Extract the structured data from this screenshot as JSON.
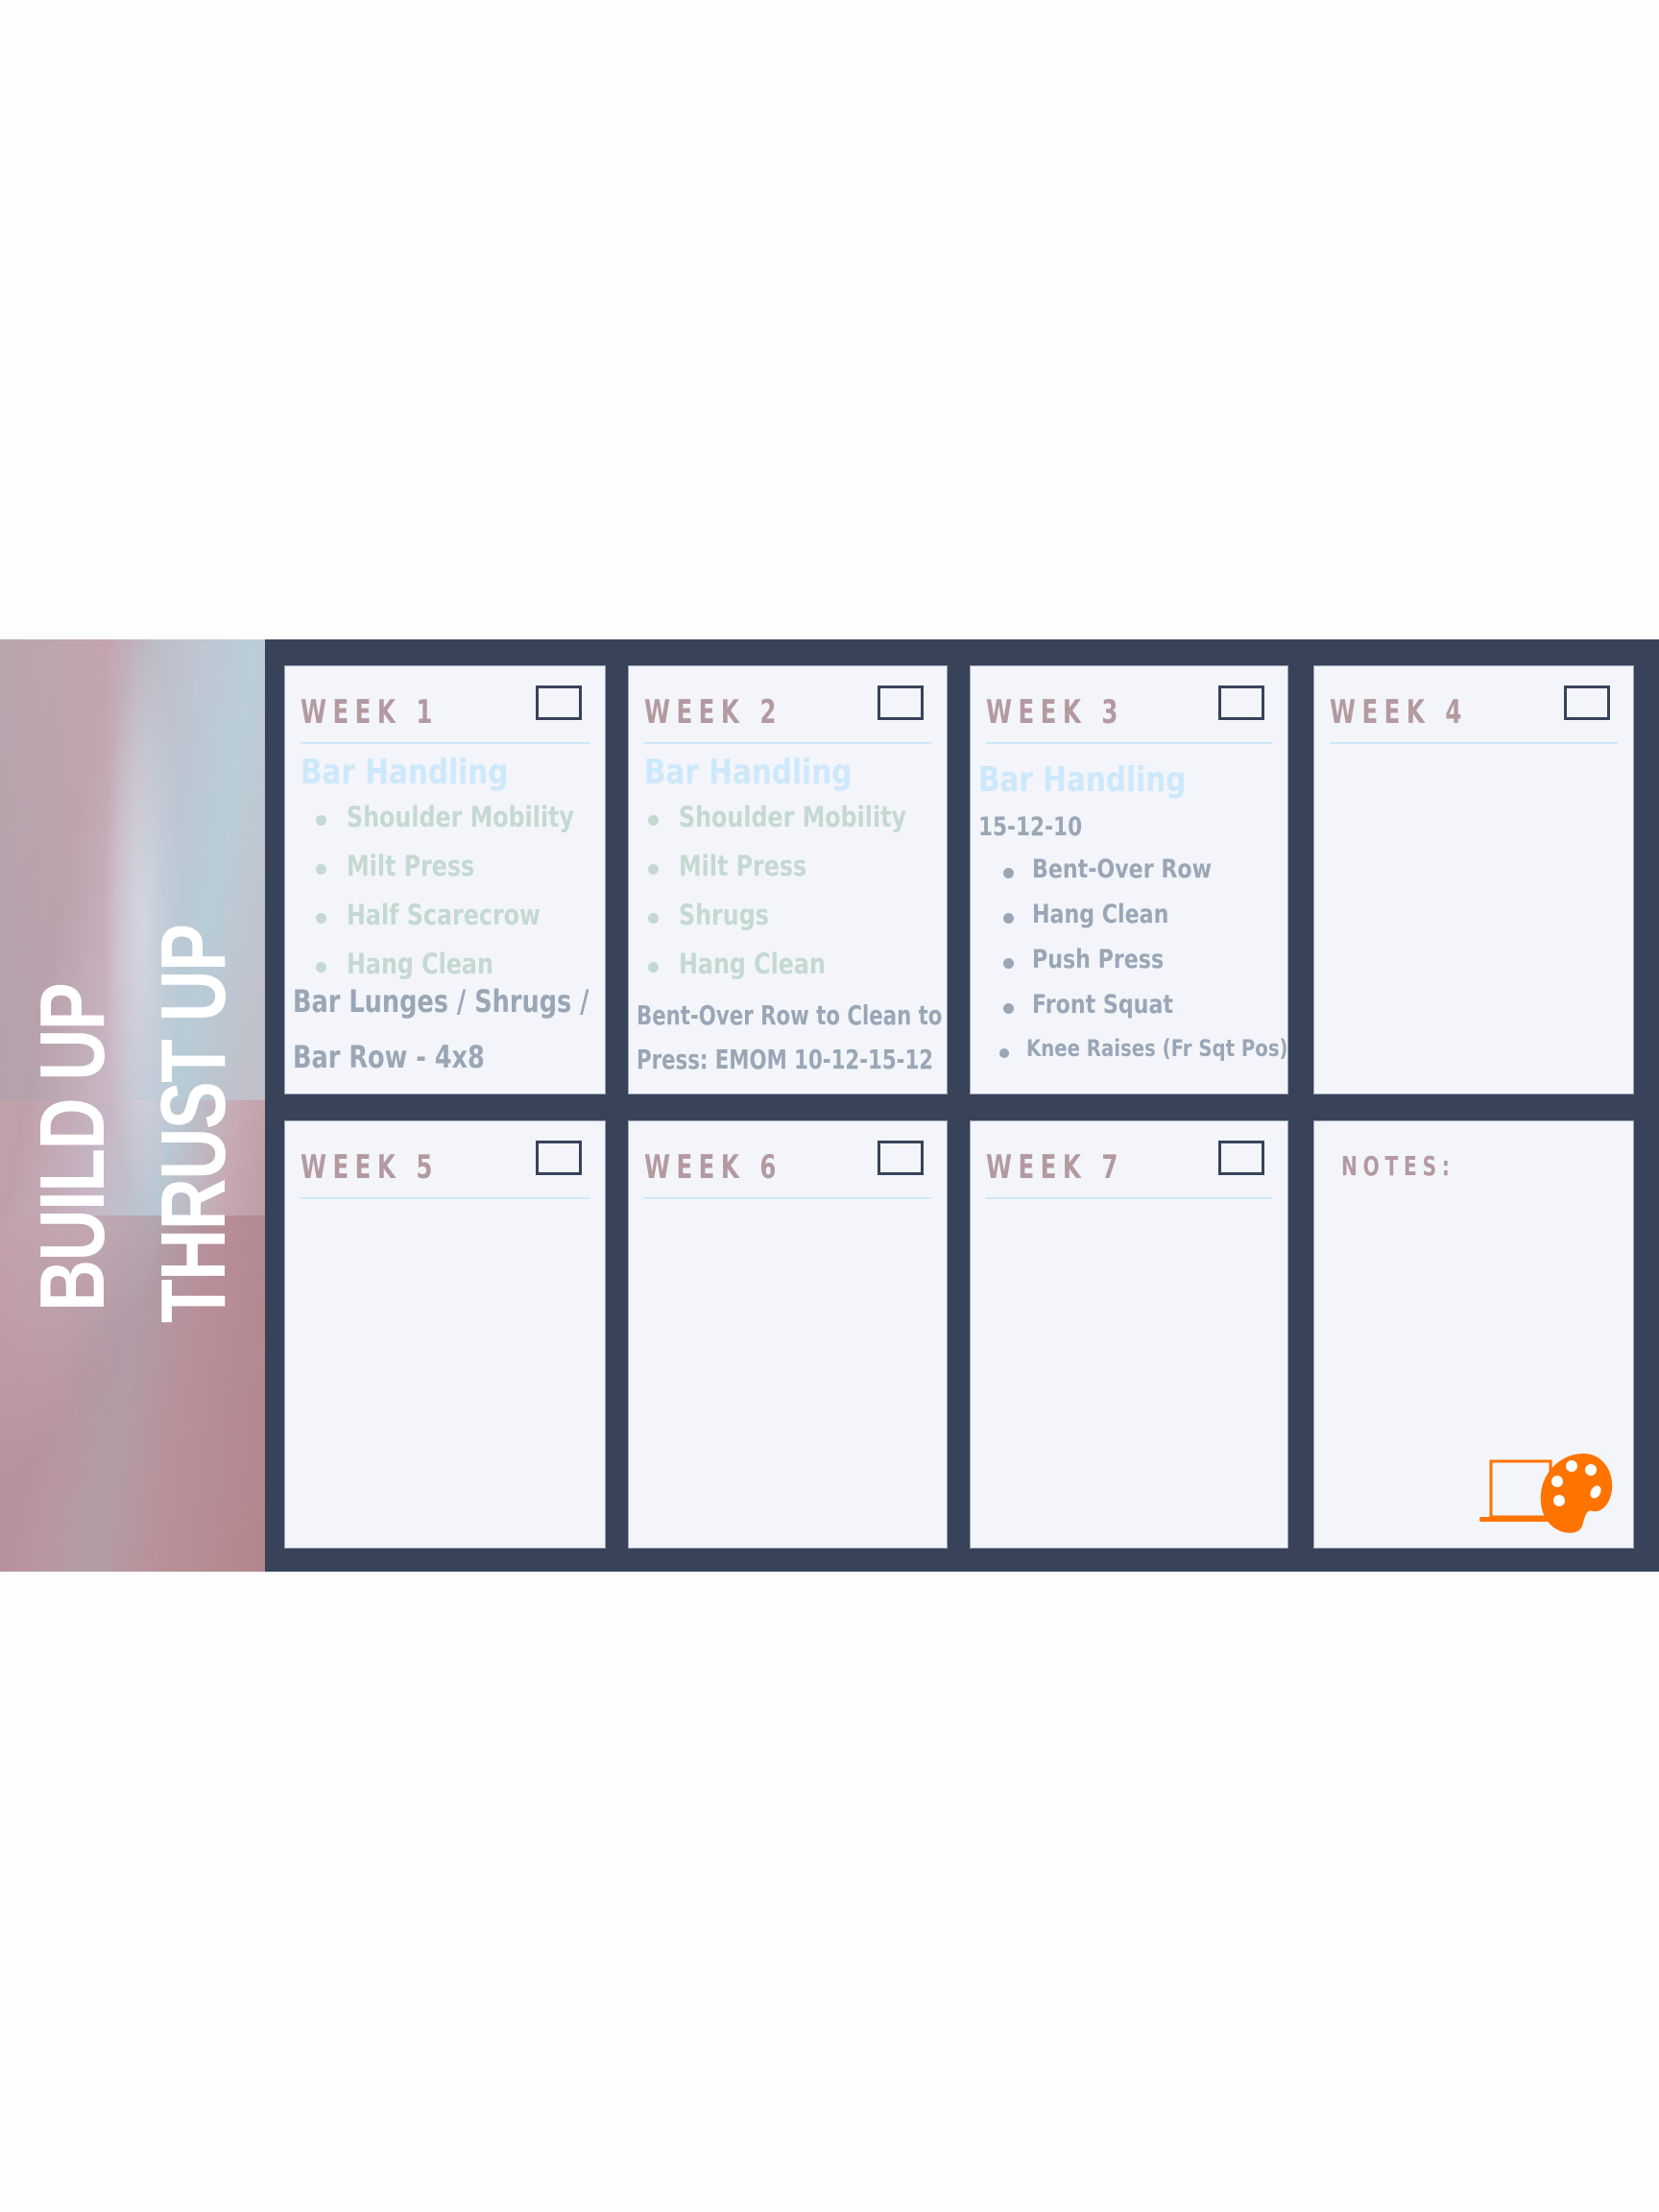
{
  "sidebar": {
    "title_lines": [
      "BUILD UP",
      "THRUST UP"
    ]
  },
  "weeks": [
    {
      "title": "WEEK 1",
      "section_title": "Bar Handling",
      "warmup": [
        "Shoulder Mobility",
        "Milt Press",
        "Half Scarecrow",
        "Hang Clean"
      ],
      "footnote_lines": [
        "Bar Lunges / Shrugs /",
        "Bar Row - 4x8"
      ],
      "checked": false
    },
    {
      "title": "WEEK 2",
      "section_title": "Bar Handling",
      "warmup": [
        "Shoulder Mobility",
        "Milt Press",
        "Shrugs",
        "Hang Clean"
      ],
      "footnote_lines": [
        "Bent-Over Row to Clean to",
        "Press: EMOM 10-12-15-12"
      ],
      "checked": false
    },
    {
      "title": "WEEK 3",
      "section_title": "Bar Handling",
      "scheme": "15-12-10",
      "exercises": [
        "Bent-Over Row",
        "Hang Clean",
        "Push Press",
        "Front Squat",
        "Knee Raises (Fr Sqt Pos)"
      ],
      "checked": false
    },
    {
      "title": "WEEK 4",
      "checked": false
    },
    {
      "title": "WEEK 5",
      "checked": false
    },
    {
      "title": "WEEK 6",
      "checked": false
    },
    {
      "title": "WEEK 7",
      "checked": false
    }
  ],
  "notes": {
    "title": "NOTES:",
    "logo_icon": "laptop-palette-icon"
  },
  "colors": {
    "band": "#38435a",
    "card": "#f3f5fa",
    "week_title": "#b39aa0",
    "section_title": "#cde8fb",
    "warmup": "#c4d9d1",
    "body_text": "#9aa6b6",
    "logo": "#ff7300"
  }
}
